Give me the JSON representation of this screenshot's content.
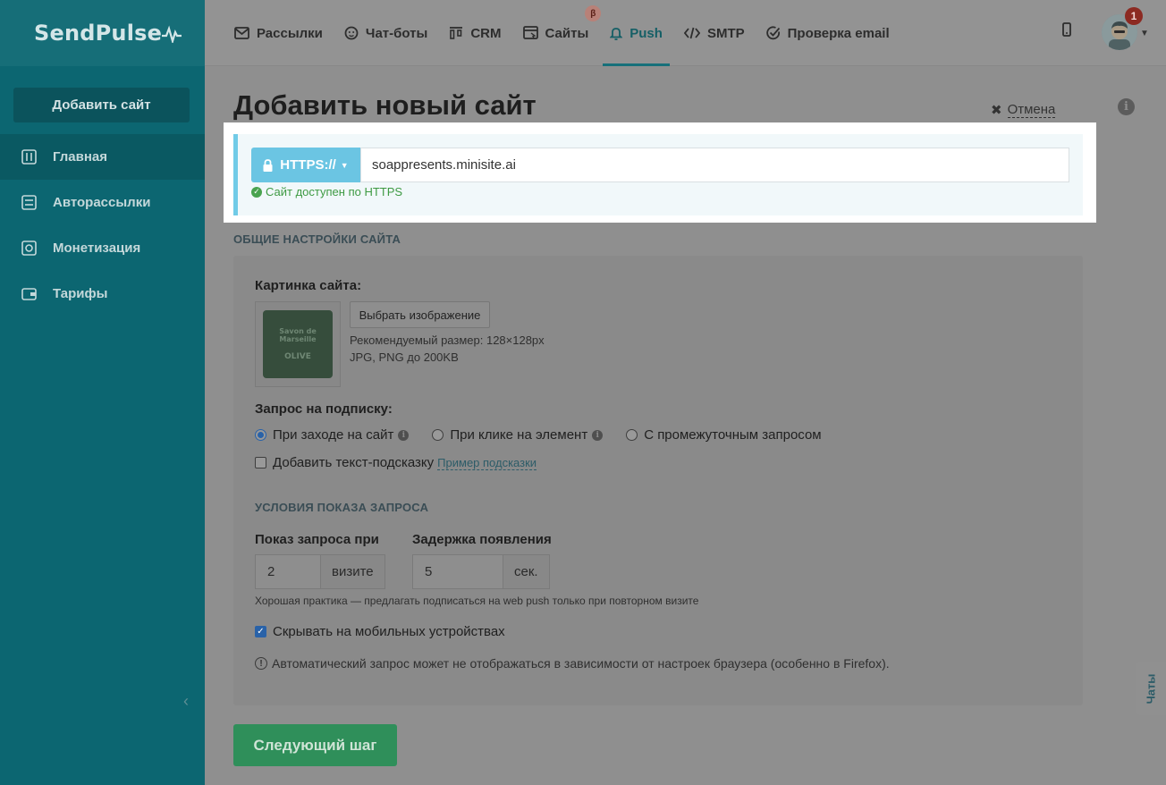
{
  "brand": {
    "name": "SendPulse"
  },
  "sidebar": {
    "add_site_label": "Добавить сайт",
    "items": [
      {
        "label": "Главная",
        "icon": "sliders-icon",
        "active": true
      },
      {
        "label": "Авторассылки",
        "icon": "automation-icon",
        "active": false
      },
      {
        "label": "Монетизация",
        "icon": "monetization-icon",
        "active": false
      },
      {
        "label": "Тарифы",
        "icon": "wallet-icon",
        "active": false
      }
    ],
    "collapse_glyph": "‹"
  },
  "topnav": {
    "items": [
      {
        "label": "Рассылки",
        "icon": "envelope-icon"
      },
      {
        "label": "Чат-боты",
        "icon": "chatbot-icon"
      },
      {
        "label": "CRM",
        "icon": "kanban-icon"
      },
      {
        "label": "Сайты",
        "icon": "site-icon",
        "badge": "β"
      },
      {
        "label": "Push",
        "icon": "bell-icon",
        "active": true
      },
      {
        "label": "SMTP",
        "icon": "code-icon"
      },
      {
        "label": "Проверка email",
        "icon": "check-circle-icon"
      }
    ],
    "notification_count": "1"
  },
  "page": {
    "title": "Добавить новый сайт",
    "cancel_label": "Отмена"
  },
  "url": {
    "protocol_label": "HTTPS://",
    "value": "soappresents.minisite.ai",
    "status": "Сайт доступен по HTTPS"
  },
  "section": {
    "general_title": "ОБЩИЕ НАСТРОЙКИ САЙТА",
    "image_label": "Картинка сайта:",
    "choose_image": "Выбрать изображение",
    "size_hint": "Рекомендуемый размер: 128×128px",
    "format_hint": "JPG, PNG до 200KB",
    "soap_text": [
      "Savon de",
      "Marseille",
      "OLIVE"
    ],
    "subscription_label": "Запрос на подписку:",
    "options": [
      {
        "label": "При заходе на сайт",
        "checked": true,
        "info": true
      },
      {
        "label": "При клике на элемент",
        "checked": false,
        "info": true
      },
      {
        "label": "С промежуточным запросом",
        "checked": false,
        "info": false
      }
    ],
    "add_hint_label": "Добавить текст-подсказку",
    "hint_example_link": "Пример подсказки",
    "conditions_title": "УСЛОВИЯ ПОКАЗА ЗАПРОСА",
    "show_on_label": "Показ запроса при",
    "show_on_value": "2",
    "show_on_unit": "визите",
    "delay_label": "Задержка появления",
    "delay_value": "5",
    "delay_unit": "сек.",
    "practice_hint": "Хорошая практика — предлагать подписаться на web push только при повторном визите",
    "hide_mobile_label": "Скрывать на мобильных устройствах",
    "hide_mobile_checked": true,
    "warning": "Автоматический запрос может не отображаться в зависимости от настроек браузера (особенно в Firefox)."
  },
  "next_button": "Следующий шаг",
  "chat_tab": "Чаты"
}
